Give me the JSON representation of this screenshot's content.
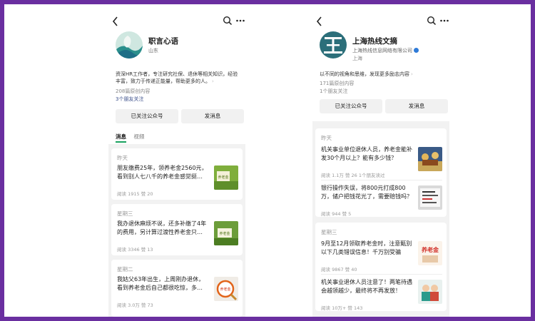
{
  "left": {
    "account": {
      "name": "职言心语",
      "location": "山东",
      "desc": "资深HR工作者，专注研究社保、退休等相关知识，经验丰富，致力于传递正能量，帮助更多的人。",
      "articles": "208篇原创内容",
      "friends": "3个朋友关注"
    },
    "buttons": {
      "follow": "已关注公众号",
      "message": "发消息"
    },
    "tabs": [
      "消息",
      "视频"
    ],
    "groups": [
      {
        "day": "昨天",
        "items": [
          {
            "title": "朋友缴费25年，领养老金2560元，看到别人七八千的养老金感觉挺…",
            "reads": "阅读 1915",
            "likes": "赞 20"
          }
        ]
      },
      {
        "day": "星期三",
        "items": [
          {
            "title": "我办退休麻烦不说，还多补缴了4年的费用，另计算过渡性养老金只…",
            "reads": "阅读 3346",
            "likes": "赞 13"
          }
        ]
      },
      {
        "day": "星期二",
        "items": [
          {
            "title": "我姑父63年出生，上周刚办退休，看到养老金后自己都很吃惊，多…",
            "reads": "阅读 3.0万",
            "likes": "赞 73"
          }
        ]
      }
    ]
  },
  "right": {
    "account": {
      "name": "上海热线文摘",
      "company": "上海热线信息网络有限公司",
      "location": "上海",
      "desc": "以不同的视角和思维，发现更多励志内容",
      "articles": "171篇原创内容",
      "friends": "1个朋友关注"
    },
    "buttons": {
      "follow": "已关注公众号",
      "message": "发消息"
    },
    "groups": [
      {
        "day": "昨天",
        "items": [
          {
            "title": "机关事业单位退休人员，养老金能补发30个月以上？能有多少钱？",
            "reads": "阅读 1.1万",
            "likes": "赞 26",
            "extra": "1个朋友读过"
          },
          {
            "title": "银行操作失误，将800元打成800万，储户把钱花光了，需要赔钱吗？",
            "reads": "阅读 944",
            "likes": "赞 5"
          }
        ]
      },
      {
        "day": "星期三",
        "items": [
          {
            "title": "9月至12月领取养老金时，注意甄别以下几类错误信息！千万别受骗",
            "reads": "阅读 9867",
            "likes": "赞 40"
          },
          {
            "title": "机关事业退休人员注意了！两笔待遇会越领越少，最终将不再发放！",
            "reads": "阅读 10万+",
            "likes": "赞 143"
          }
        ]
      }
    ],
    "thumb_text": {
      "pension": "养老金"
    }
  },
  "thumb_text": {
    "yanglaojin": "养老金"
  },
  "colors": {
    "background": "#6a2fa0",
    "accent": "#19a15f",
    "link": "#3a4e8a"
  }
}
